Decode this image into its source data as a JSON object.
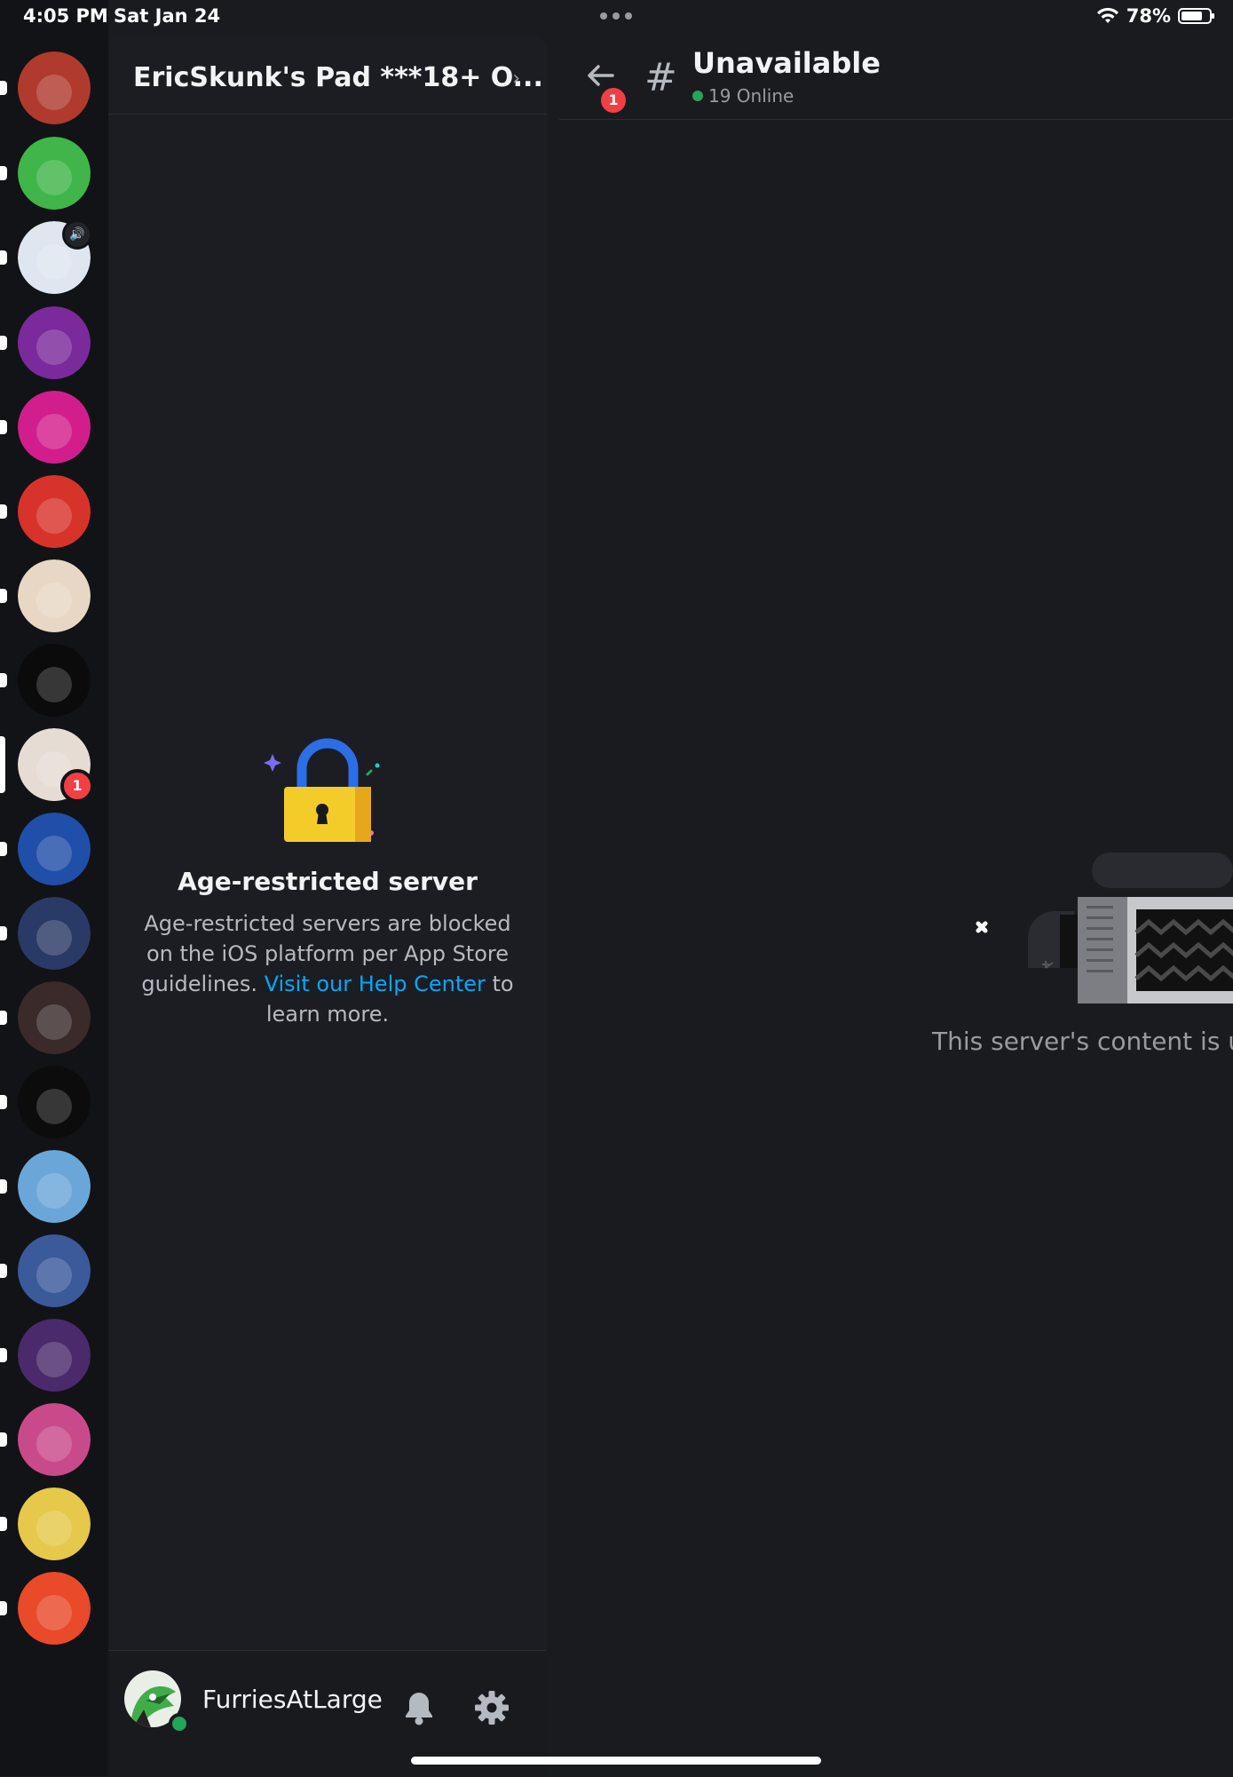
{
  "status_bar": {
    "time": "4:05 PM",
    "date": "Sat Jan 24",
    "battery": "78%",
    "battery_level": 0.78
  },
  "server_list": {
    "items": [
      {
        "icon": "server-avatar-red-creature",
        "color": "#b03a2e",
        "unread": true
      },
      {
        "icon": "server-avatar-orange-fox",
        "color": "#3fb54a",
        "unread": true
      },
      {
        "icon": "server-avatar-white-bear",
        "color": "#dfe6ef",
        "unread": true,
        "voice": true
      },
      {
        "icon": "server-avatar-pink-heart",
        "color": "#7a2a9a",
        "unread": true
      },
      {
        "icon": "server-avatar-pink-wolf",
        "color": "#d21e8c",
        "unread": true
      },
      {
        "icon": "server-avatar-red-lion",
        "color": "#d8332a",
        "unread": true
      },
      {
        "icon": "server-avatar-green-croc",
        "color": "#e8d7c4",
        "unread": true
      },
      {
        "icon": "server-avatar-white-wolf",
        "color": "#0b0b0c",
        "unread": true
      },
      {
        "icon": "server-avatar-skunk",
        "color": "#e5dcd3",
        "selected": true,
        "mentions": "1"
      },
      {
        "icon": "server-avatar-blue-paw",
        "color": "#1f4fa8",
        "unread": true
      },
      {
        "icon": "server-avatar-blue-heart-wolf",
        "color": "#2a3a66",
        "unread": true
      },
      {
        "icon": "server-avatar-fat-furs",
        "color": "#3a2a2a",
        "unread": true
      },
      {
        "icon": "server-avatar-bear-hat",
        "color": "#0c0c0c",
        "unread": true
      },
      {
        "icon": "server-avatar-fox-sky",
        "color": "#6aa7d8",
        "unread": true
      },
      {
        "icon": "server-avatar-snow-forest",
        "color": "#3a5a9a",
        "unread": true
      },
      {
        "icon": "server-avatar-purple-city",
        "color": "#4a2a6a",
        "unread": true
      },
      {
        "icon": "server-avatar-fox-heart",
        "color": "#c94a8a",
        "unread": true
      },
      {
        "icon": "server-avatar-gold-crown",
        "color": "#e6c84a",
        "unread": true
      },
      {
        "icon": "server-avatar-rainbow-paw",
        "color": "#e84a2a",
        "unread": true
      }
    ]
  },
  "channel_panel": {
    "server_name": "EricSkunk's Pad ***18+ O...",
    "chevron": "›",
    "age_title": "Age-restricted server",
    "age_desc_1": "Age-restricted servers are blocked on the iOS platform per App Store guidelines.",
    "age_link": "Visit our Help Center",
    "age_desc_2": "to learn more.",
    "username": "FurriesAtLarge"
  },
  "main": {
    "back_badge": "1",
    "hash": "#",
    "channel_title": "Unavailable",
    "online": "19 Online",
    "unavailable_text": "This server's content is un"
  },
  "colors": {
    "accent_link": "#00a8fc",
    "online": "#23a55a",
    "danger": "#f23f43"
  }
}
